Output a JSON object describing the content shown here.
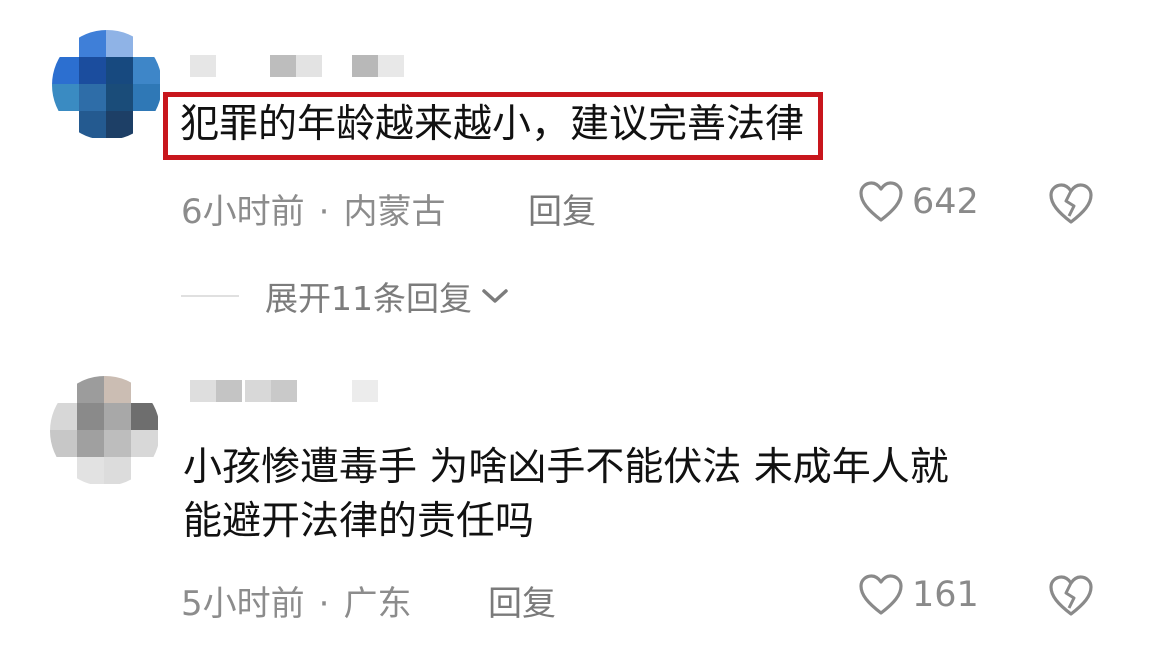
{
  "comments": [
    {
      "text": "犯罪的年龄越来越小，建议完善法律",
      "time": "6小时前",
      "location": "内蒙古",
      "reply_label": "回复",
      "likes": "642",
      "expand_label": "展开11条回复",
      "highlighted": true
    },
    {
      "text_line1": "小孩惨遭毒手 为啥凶手不能伏法  未成年人就",
      "text_line2": "能避开法律的责任吗",
      "time": "5小时前",
      "location": "广东",
      "reply_label": "回复",
      "likes": "161"
    }
  ],
  "colors": {
    "highlight_border": "#c8161d",
    "meta_gray": "#8c8c8c"
  },
  "icons": [
    "heart-outline-icon",
    "broken-heart-icon",
    "chevron-down-icon"
  ]
}
